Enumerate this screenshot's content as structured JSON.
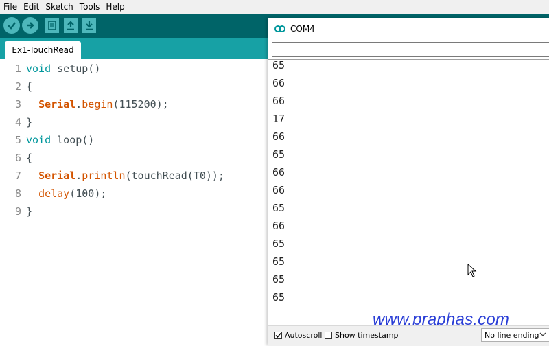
{
  "menu": [
    "File",
    "Edit",
    "Sketch",
    "Tools",
    "Help"
  ],
  "toolbar": {
    "buttons": [
      "verify-icon",
      "upload-icon",
      "new-icon",
      "open-icon",
      "save-icon"
    ]
  },
  "tab": {
    "label": "Ex1-TouchRead"
  },
  "editor": {
    "line_numbers": [
      "1",
      "2",
      "3",
      "4",
      "5",
      "6",
      "7",
      "8",
      "9"
    ],
    "l1": {
      "kw": "void",
      "rest": " setup()"
    },
    "l2": "{",
    "l3": {
      "indent": "  ",
      "obj": "Serial",
      "dot": ".",
      "fn": "begin",
      "rest": "(115200);"
    },
    "l4": "}",
    "l5": {
      "kw": "void",
      "rest": " loop()"
    },
    "l6": "{",
    "l7": {
      "indent": "  ",
      "obj": "Serial",
      "dot": ".",
      "fn": "println",
      "rest": "(touchRead(T0));"
    },
    "l8": {
      "indent": "  ",
      "fn": "delay",
      "rest": "(100);"
    },
    "l9": "}"
  },
  "serial_monitor": {
    "title": "COM4",
    "send_value": "",
    "output": [
      "65",
      "66",
      "66",
      "17",
      "66",
      "65",
      "66",
      "66",
      "65",
      "66",
      "65",
      "65",
      "65",
      "65"
    ],
    "autoscroll_label": "Autoscroll",
    "autoscroll_checked": true,
    "timestamp_label": "Show timestamp",
    "timestamp_checked": false,
    "line_ending": "No line ending"
  },
  "watermark": "www.praphas.com",
  "colors": {
    "toolbar": "#006468",
    "tabbar": "#17a1a5",
    "button": "#4db7bb",
    "keyword": "#00979c",
    "function": "#d35400",
    "watermark": "#2a3ed6"
  }
}
